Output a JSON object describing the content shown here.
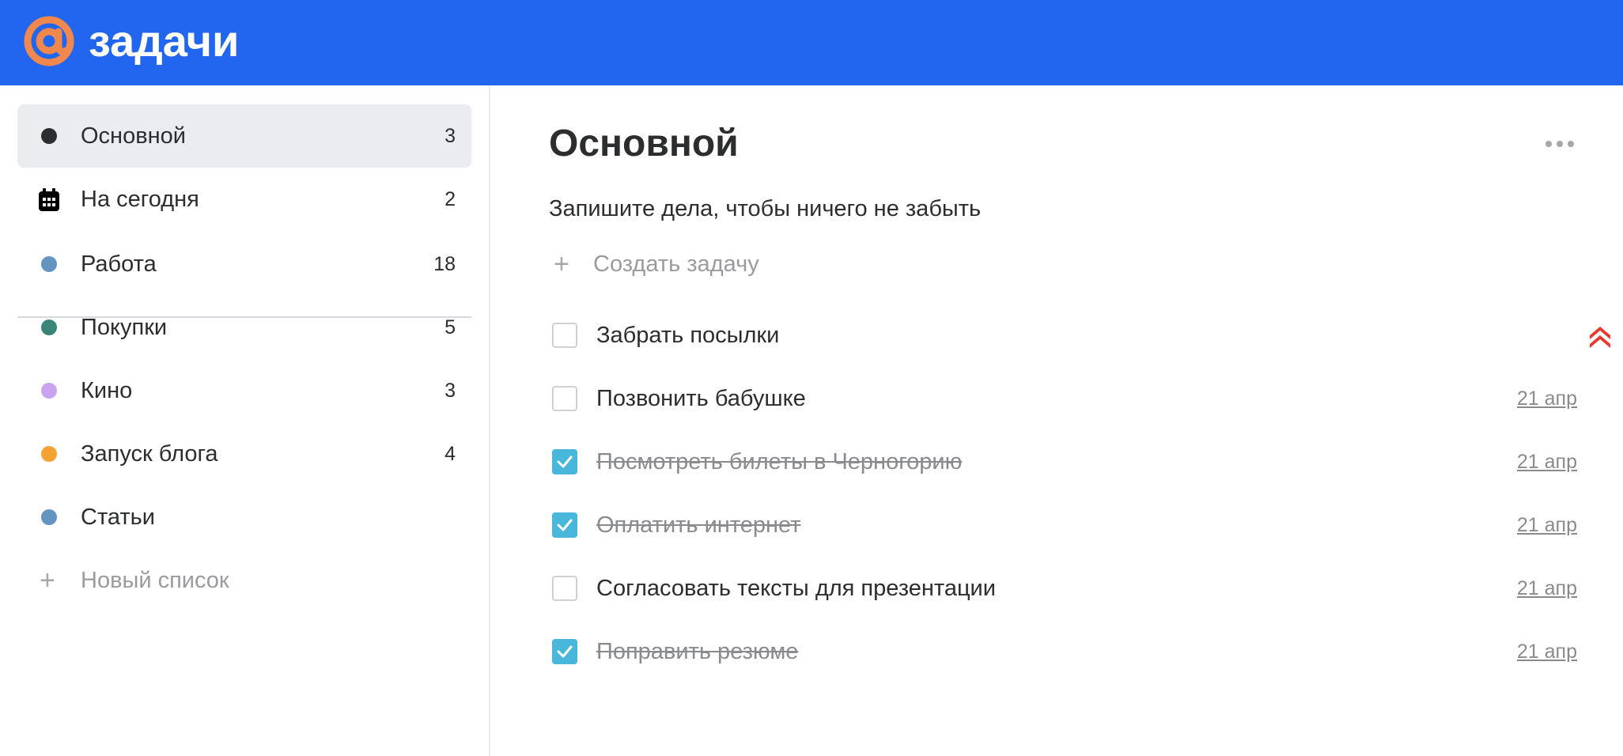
{
  "header": {
    "logo_text": "задачи",
    "colors": {
      "bar": "#2266f0",
      "logo_mark": "#f0884d"
    }
  },
  "sidebar": {
    "items": [
      {
        "label": "Основной",
        "count": "3",
        "icon": "dot-icon",
        "color": "#2c2d2e",
        "active": true
      },
      {
        "label": "На сегодня",
        "count": "2",
        "icon": "calendar-icon",
        "color": "#000000",
        "active": false
      },
      {
        "label": "Работа",
        "count": "18",
        "icon": "dot-icon",
        "color": "#6494c0",
        "active": false
      },
      {
        "label": "Покупки",
        "count": "5",
        "icon": "dot-icon",
        "color": "#3a8478",
        "active": false
      },
      {
        "label": "Кино",
        "count": "3",
        "icon": "dot-icon",
        "color": "#c9a3f0",
        "active": false
      },
      {
        "label": "Запуск блога",
        "count": "4",
        "icon": "dot-icon",
        "color": "#f5a235",
        "active": false
      },
      {
        "label": "Статьи",
        "count": "",
        "icon": "dot-icon",
        "color": "#6494c0",
        "active": false
      }
    ],
    "new_list_label": "Новый список"
  },
  "main": {
    "title": "Основной",
    "subtitle": "Запишите дела, чтобы ничего не забыть",
    "create_label": "Создать задачу",
    "more_icon": "more-dots-icon",
    "tasks": [
      {
        "text": "Забрать посылки",
        "done": false,
        "date": "",
        "high_priority": true
      },
      {
        "text": "Позвонить бабушке",
        "done": false,
        "date": "21 апр",
        "high_priority": false
      },
      {
        "text": "Посмотреть билеты в Черногорию",
        "done": true,
        "date": "21 апр",
        "high_priority": false
      },
      {
        "text": "Оплатить интернет",
        "done": true,
        "date": "21 апр",
        "high_priority": false
      },
      {
        "text": "Согласовать тексты для презентации",
        "done": false,
        "date": "21 апр",
        "high_priority": false
      },
      {
        "text": "Поправить резюме",
        "done": true,
        "date": "21 апр",
        "high_priority": false
      }
    ],
    "colors": {
      "checkbox_checked": "#49b7dc",
      "priority": "#e8392c"
    }
  }
}
